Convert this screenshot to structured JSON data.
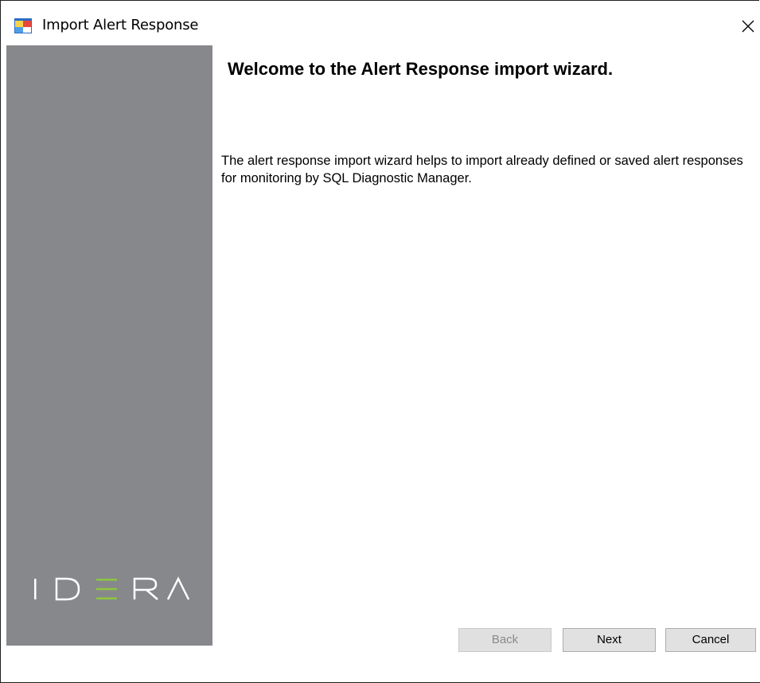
{
  "window": {
    "title": "Import Alert Response",
    "app_icon": "app-window-icon",
    "close_icon": "close-icon"
  },
  "sidebar": {
    "logo_text": "IDERA",
    "background": "#87888b",
    "logo_accent": "#8dc63f"
  },
  "main": {
    "headline": "Welcome to the Alert Response import wizard.",
    "description": "The alert response import wizard helps to import already defined or saved alert responses for monitoring by SQL Diagnostic Manager."
  },
  "footer": {
    "back_label": "Back",
    "back_enabled": false,
    "next_label": "Next",
    "cancel_label": "Cancel"
  }
}
